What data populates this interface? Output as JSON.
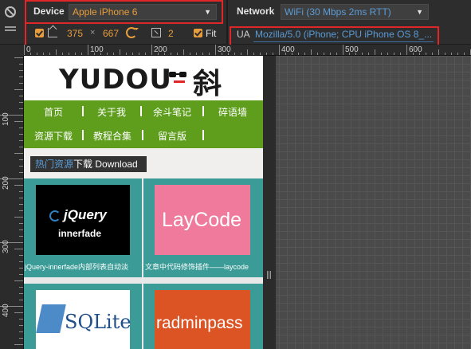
{
  "toolbar": {
    "device_label": "Device",
    "device_value": "Apple iPhone 6",
    "network_label": "Network",
    "network_value": "WiFi (30 Mbps 2ms RTT)",
    "width": "375",
    "times": "×",
    "height": "667",
    "scale": "2",
    "fit_label": "Fit",
    "ua_label": "UA",
    "ua_value": "Mozilla/5.0 (iPhone; CPU iPhone OS 8_..."
  },
  "ruler": {
    "top_labels": [
      "0",
      "100",
      "200",
      "300",
      "400",
      "500",
      "600"
    ],
    "left_labels": [
      "100",
      "200",
      "300",
      "400"
    ]
  },
  "site": {
    "logo_text": "YUDOU",
    "logo_char": "斜",
    "nav_row1": [
      "首页",
      "关于我",
      "余斗笔记",
      "碎语墙"
    ],
    "nav_row2": [
      "资源下载",
      "教程合集",
      "留言版"
    ],
    "section_hot": "热门资源",
    "section_download": "下载 Download",
    "cards": [
      {
        "thumb_line1": "jQuery",
        "thumb_line2": "innerfade",
        "title": "jQuery-innerfade内部列表自动淡"
      },
      {
        "thumb_line1": "LayCode",
        "thumb_line2": "",
        "title": "文章中代码修饰插件——laycode"
      },
      {
        "thumb_line1": "SQLite",
        "thumb_line2": "",
        "title": ""
      },
      {
        "thumb_line1": "radminpass",
        "thumb_line2": "",
        "title": ""
      }
    ]
  },
  "colors": {
    "accent_orange": "#e79d3c",
    "link_blue": "#5b9bd5",
    "nav_green": "#5e9e1c",
    "grid_teal": "#3a9b97",
    "highlight_red": "#e02626"
  }
}
